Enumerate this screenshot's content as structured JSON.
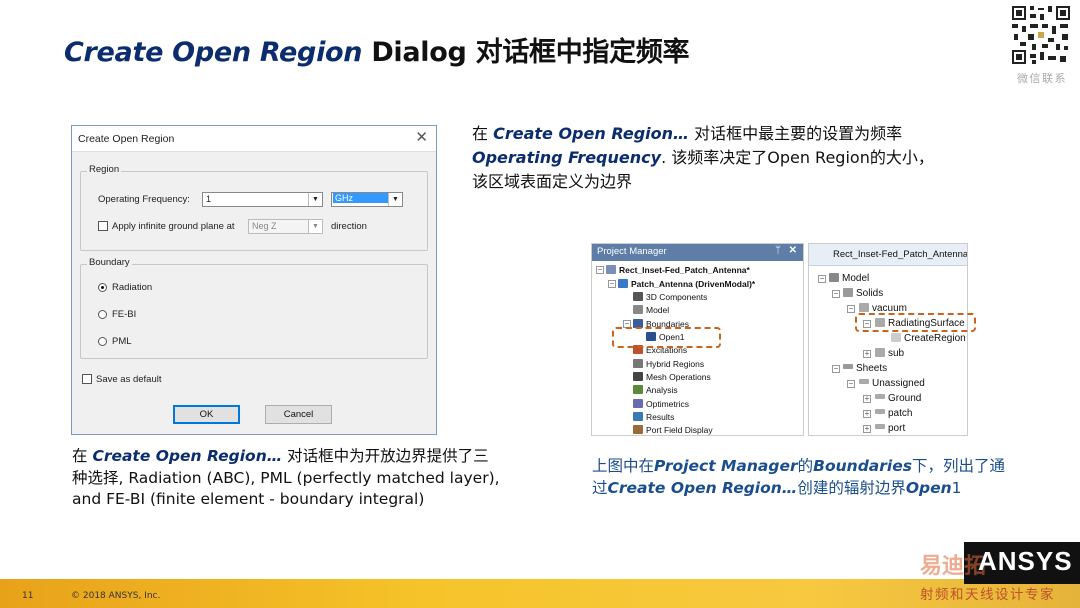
{
  "slide": {
    "title_italic": "Create Open Region",
    "title_rest": " Dialog 对话框中指定频率",
    "qr_caption": "微信联系",
    "page_number": "11",
    "copyright": "© 2018 ANSYS, Inc.",
    "brand": "ANSYS",
    "watermark_logo": "易迪拓",
    "watermark_text": "射频和天线设计专家",
    "colors": {
      "title_accent": "#0b2d6e",
      "footer": "#f6c42a",
      "highlight": "#c8641e",
      "caption_blue": "#1a4d8e"
    }
  },
  "dialog": {
    "title": "Create Open Region",
    "region_label": "Region",
    "freq_label": "Operating Frequency:",
    "freq_value": "1",
    "freq_unit": "GHz",
    "ground_label": "Apply infinite ground plane at",
    "ground_value": "Neg Z",
    "direction_label": "direction",
    "boundary_label": "Boundary",
    "options": [
      "Radiation",
      "FE-BI",
      "PML"
    ],
    "selected_option": "Radiation",
    "save_default_label": "Save as default",
    "ok_label": "OK",
    "cancel_label": "Cancel"
  },
  "text_top": {
    "p1": "在 ",
    "p2": "Create Open Region…",
    "p3": " 对话框中最主要的设置为频率",
    "p4": "Operating Frequency",
    "p5": ". 该频率决定了Open Region的大小，",
    "p6": "该区域表面定义为边界"
  },
  "text_left": {
    "p1": "在  ",
    "p2": "Create Open Region…",
    "p3": " 对话框中为开放边界提供了三种选择, Radiation (ABC), PML (perfectly matched layer), and FE-BI (finite element - boundary integral)"
  },
  "text_right": {
    "p1": "上图中在",
    "p2": "Project Manager",
    "p3": "的",
    "p4": "Boundaries",
    "p5": "下，列出了通过",
    "p6": "Create Open Region…",
    "p7": "创建的辐射边界",
    "p8": "Open",
    "p9": "1"
  },
  "project_manager": {
    "header": "Project Manager",
    "pin_icon": "pin-icon",
    "items": [
      "Rect_Inset-Fed_Patch_Antenna*",
      "Patch_Antenna (DrivenModal)*",
      "3D Components",
      "Model",
      "Boundaries",
      "Open1",
      "Excitations",
      "Hybrid Regions",
      "Mesh Operations",
      "Analysis",
      "Optimetrics",
      "Results",
      "Port Field Display"
    ]
  },
  "model_tree": {
    "header": "Rect_Inset-Fed_Patch_Antenna",
    "items": [
      "Model",
      "Solids",
      "vacuum",
      "RadiatingSurface",
      "CreateRegion",
      "sub",
      "Sheets",
      "Unassigned",
      "Ground",
      "patch",
      "port"
    ]
  }
}
